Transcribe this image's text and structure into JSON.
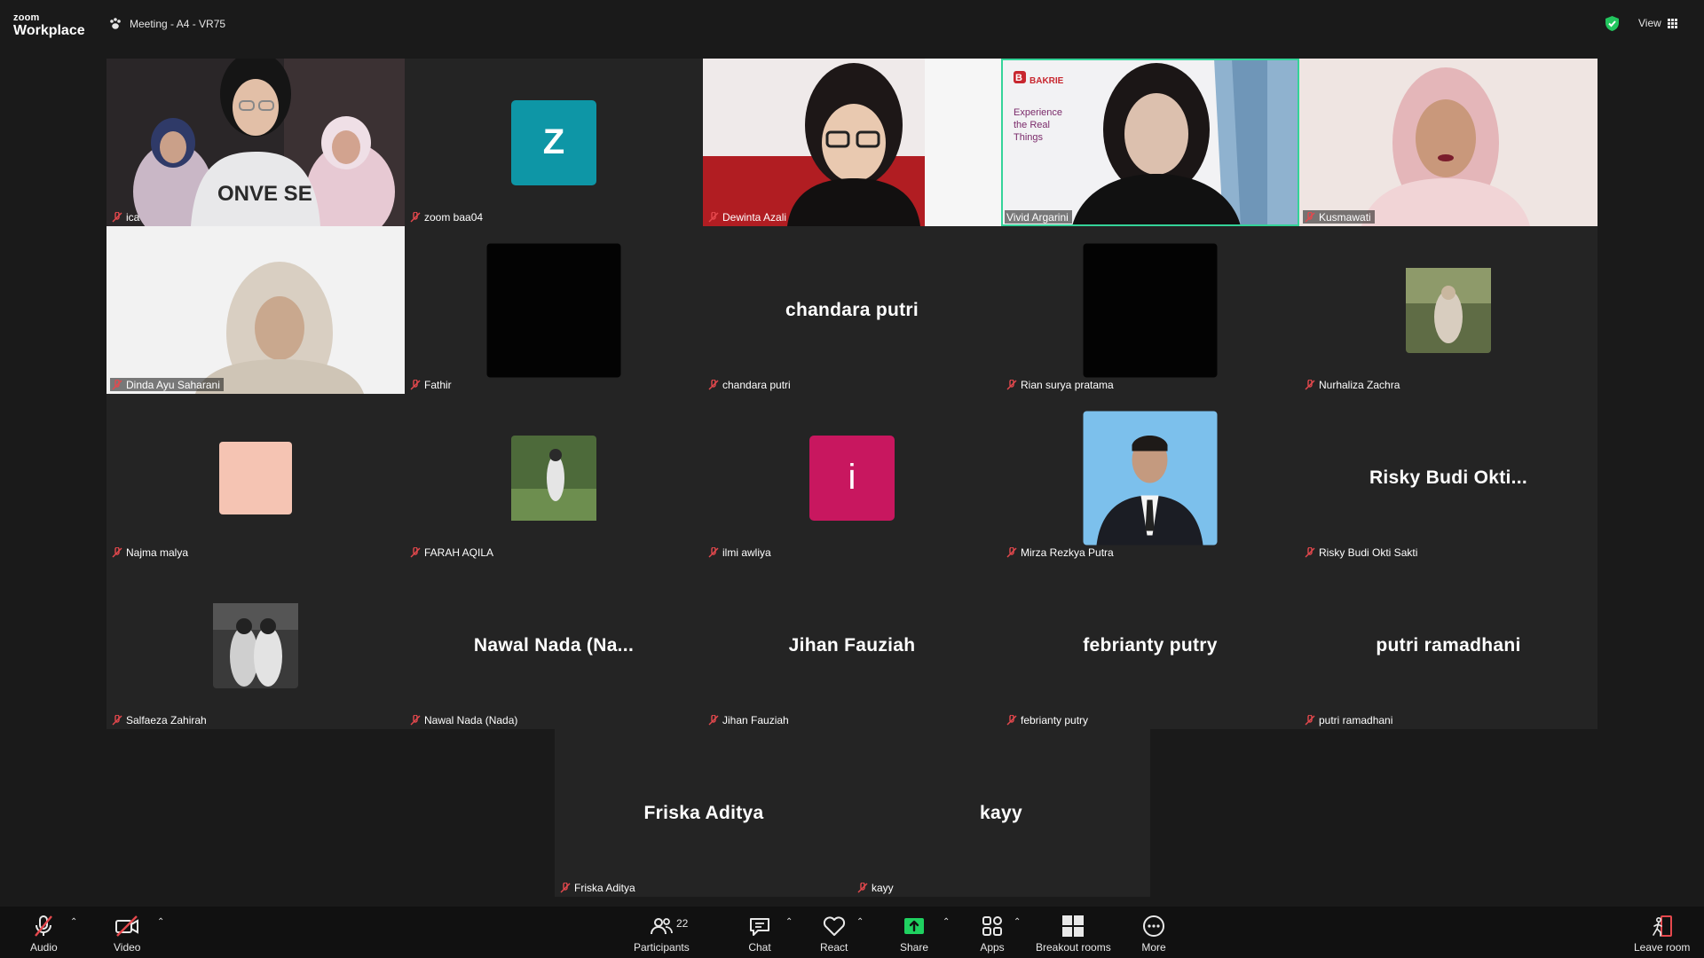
{
  "app": {
    "brand_top": "zoom",
    "brand_bottom": "Workplace",
    "meeting_title": "Meeting - A4 - VR75",
    "view_label": "View",
    "shield_color": "#22c55e"
  },
  "active_speaker_color": "#34d399",
  "participants": [
    {
      "name": "ica",
      "display": "video"
    },
    {
      "name": "zoom baa04",
      "display": "initial",
      "initial": "Z",
      "color": "#0e96a6"
    },
    {
      "name": "Dewinta Azali",
      "display": "video"
    },
    {
      "name": "Vivid Argarini",
      "display": "video",
      "speaking": true,
      "overlay": {
        "brand": "BAKRIE",
        "tagline": "Experience the Real Things"
      }
    },
    {
      "name": "Kusmawati",
      "display": "video"
    },
    {
      "name": "Dinda Ayu Saharani",
      "display": "video"
    },
    {
      "name": "Fathir",
      "display": "black-avatar"
    },
    {
      "name": "chandara putri",
      "display": "name",
      "big_name": "chandara putri"
    },
    {
      "name": "Rian surya pratama",
      "display": "black-avatar"
    },
    {
      "name": "Nurhaliza Zachra",
      "display": "photo-avatar"
    },
    {
      "name": "Najma malya",
      "display": "color-avatar",
      "color": "#f5c4b3"
    },
    {
      "name": "FARAH AQILA",
      "display": "photo-avatar"
    },
    {
      "name": "ilmi awliya",
      "display": "initial",
      "initial": "i",
      "color": "#c8175f"
    },
    {
      "name": "Mirza Rezkya Putra",
      "display": "photo-avatar-large"
    },
    {
      "name": "Risky Budi Okti Sakti",
      "display": "name",
      "big_name": "Risky Budi Okti..."
    },
    {
      "name": "Salfaeza Zahirah",
      "display": "photo-avatar"
    },
    {
      "name": "Nawal Nada (Nada)",
      "display": "name",
      "big_name": "Nawal Nada (Na..."
    },
    {
      "name": "Jihan Fauziah",
      "display": "name",
      "big_name": "Jihan Fauziah"
    },
    {
      "name": "febrianty putry",
      "display": "name",
      "big_name": "febrianty putry"
    },
    {
      "name": "putri ramadhani",
      "display": "name",
      "big_name": "putri ramadhani"
    },
    {
      "name": "Friska Aditya",
      "display": "name",
      "big_name": "Friska Aditya"
    },
    {
      "name": "kayy",
      "display": "name",
      "big_name": "kayy"
    }
  ],
  "toolbar": {
    "audio": "Audio",
    "video": "Video",
    "participants": "Participants",
    "participant_count": "22",
    "chat": "Chat",
    "react": "React",
    "share": "Share",
    "apps": "Apps",
    "breakout": "Breakout rooms",
    "more": "More",
    "leave": "Leave room",
    "share_color": "#1fd160",
    "muted_color": "#e5484d"
  }
}
